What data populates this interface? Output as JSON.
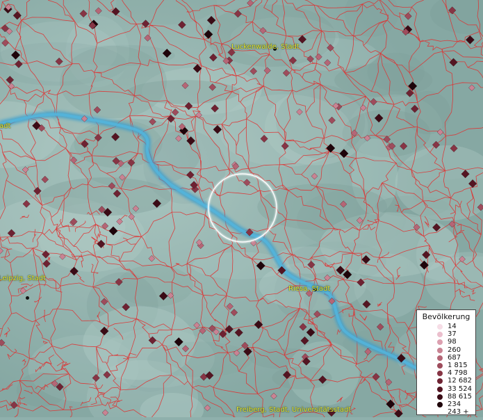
{
  "map": {
    "places": [
      {
        "name": "Luckenwalde, Stadt"
      },
      {
        "name": "Leipzig, Stadt"
      },
      {
        "name": "Riesa, Stadt"
      },
      {
        "name": "Freiberg, Stadt, Universitätsstadt"
      }
    ],
    "edge_labels": [
      "adt"
    ],
    "colors": {
      "background": "#8fb0ac",
      "boundaries": "#e03030",
      "river": "#3fa0cc",
      "label": "#e8e830",
      "focus_ring": "#ffffff"
    }
  },
  "legend": {
    "title": "Bevölkerung",
    "items": [
      {
        "label": "14",
        "color": "#f6dde6"
      },
      {
        "label": "37",
        "color": "#ebbfcd"
      },
      {
        "label": "98",
        "color": "#dca0b0"
      },
      {
        "label": "260",
        "color": "#c98393"
      },
      {
        "label": "687",
        "color": "#b56676"
      },
      {
        "label": "1 815",
        "color": "#9e4c5c"
      },
      {
        "label": "4 798",
        "color": "#873545"
      },
      {
        "label": "12 682",
        "color": "#6e2232"
      },
      {
        "label": "33 524",
        "color": "#541522"
      },
      {
        "label": "88 615",
        "color": "#3a0b15"
      },
      {
        "label": "234 243 +",
        "color": "#1e040a"
      }
    ]
  }
}
